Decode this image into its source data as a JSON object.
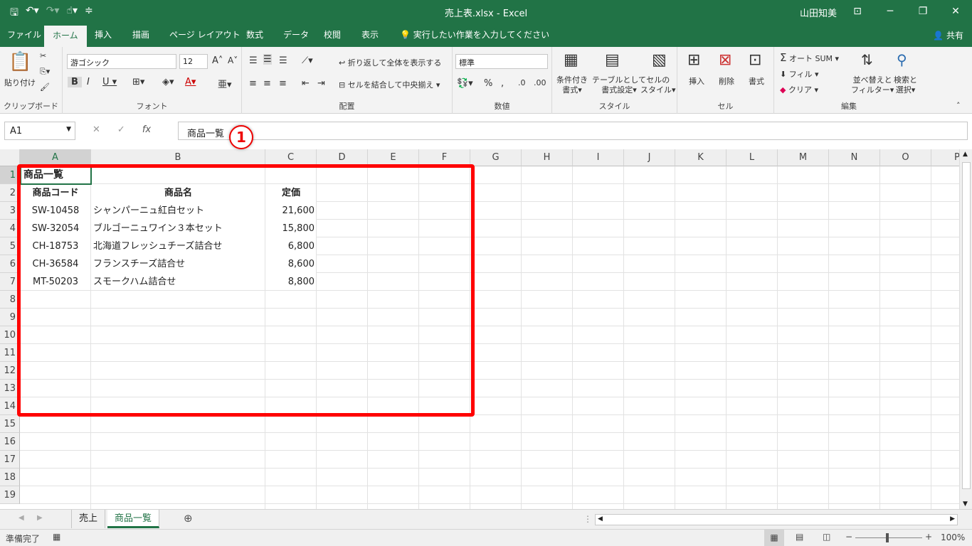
{
  "window": {
    "title": "売上表.xlsx  -  Excel",
    "user": "山田知美"
  },
  "tabs": [
    "ファイル",
    "ホーム",
    "挿入",
    "描画",
    "ページ レイアウト",
    "数式",
    "データ",
    "校閲",
    "表示"
  ],
  "tell_me": "実行したい作業を入力してください",
  "share": "共有",
  "ribbon": {
    "clipboard": {
      "paste": "貼り付け",
      "label": "クリップボード"
    },
    "font": {
      "name": "游ゴシック",
      "size": "12",
      "label": "フォント"
    },
    "alignment": {
      "wrap": "折り返して全体を表示する",
      "merge": "セルを結合して中央揃え",
      "label": "配置"
    },
    "number": {
      "format": "標準",
      "label": "数値"
    },
    "styles": {
      "conditional": [
        "条件付き",
        "書式"
      ],
      "table": [
        "テーブルとして",
        "書式設定"
      ],
      "cell": [
        "セルの",
        "スタイル"
      ],
      "label": "スタイル"
    },
    "cells": {
      "insert": "挿入",
      "delete": "削除",
      "format": "書式",
      "label": "セル"
    },
    "editing": {
      "autosum": "オート SUM",
      "fill": "フィル",
      "clear": "クリア",
      "sort": [
        "並べ替えと",
        "フィルター"
      ],
      "find": [
        "検索と",
        "選択"
      ],
      "label": "編集"
    }
  },
  "formula_bar": {
    "name_box": "A1",
    "cancel": "✕",
    "enter": "✓",
    "fx": "fx",
    "content": "商品一覧"
  },
  "annotation": {
    "badge": "1"
  },
  "columns": [
    "A",
    "B",
    "C",
    "D",
    "E",
    "F",
    "G",
    "H",
    "I",
    "J",
    "K",
    "L",
    "M",
    "N",
    "O",
    "P"
  ],
  "rows": [
    "1",
    "2",
    "3",
    "4",
    "5",
    "6",
    "7",
    "8",
    "9",
    "10",
    "11",
    "12",
    "13",
    "14",
    "15",
    "16",
    "17",
    "18",
    "19"
  ],
  "sheet": {
    "title": "商品一覧",
    "headers": [
      "商品コード",
      "商品名",
      "定価"
    ],
    "items": [
      {
        "code": "SW-10458",
        "name": "シャンパーニュ紅白セット",
        "price": "21,600"
      },
      {
        "code": "SW-32054",
        "name": "ブルゴーニュワイン３本セット",
        "price": "15,800"
      },
      {
        "code": "CH-18753",
        "name": "北海道フレッシュチーズ詰合せ",
        "price": "6,800"
      },
      {
        "code": "CH-36584",
        "name": "フランスチーズ詰合せ",
        "price": "8,600"
      },
      {
        "code": "MT-50203",
        "name": "スモークハム詰合せ",
        "price": "8,800"
      }
    ]
  },
  "sheet_tabs": [
    "売上",
    "商品一覧"
  ],
  "status": {
    "ready": "準備完了",
    "zoom": "100%"
  },
  "colors": {
    "excel_green": "#217346",
    "highlight_red": "#ff0000"
  }
}
